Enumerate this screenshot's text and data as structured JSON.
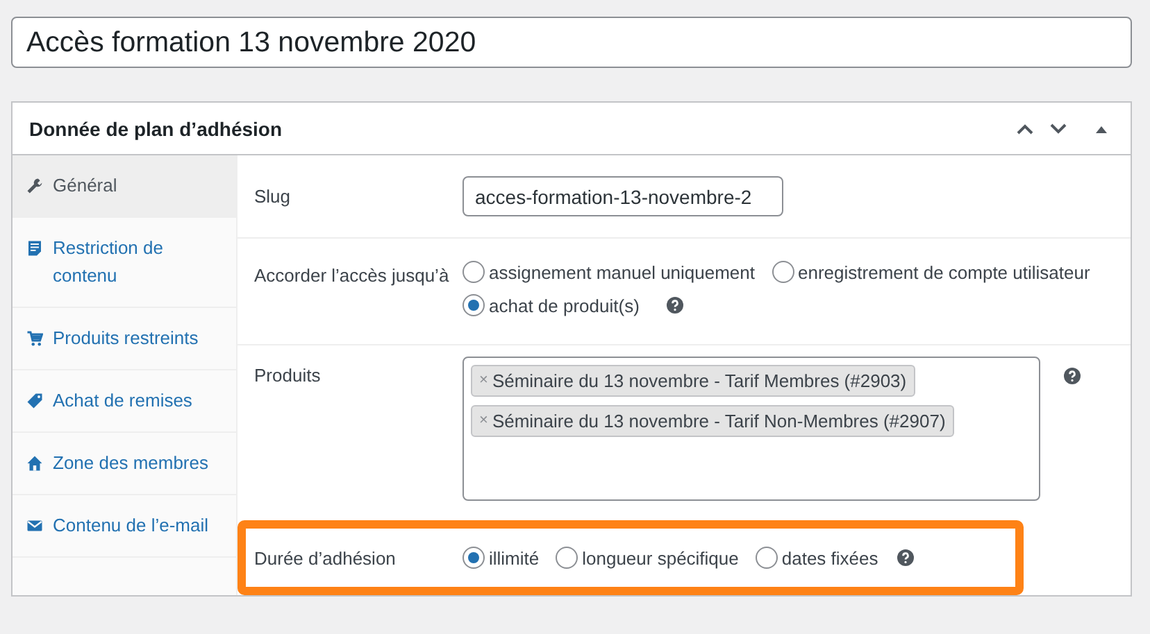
{
  "post_title": {
    "value": "Accès formation 13 novembre 2020"
  },
  "panel": {
    "title": "Donnée de plan d’adhésion"
  },
  "tabs": [
    {
      "kind": "wrench",
      "label": "Général",
      "selected": true
    },
    {
      "kind": "doc",
      "label": "Restriction de contenu",
      "selected": false
    },
    {
      "kind": "cart",
      "label": "Produits restreints",
      "selected": false
    },
    {
      "kind": "tag",
      "label": "Achat de remises",
      "selected": false
    },
    {
      "kind": "home",
      "label": "Zone des membres",
      "selected": false
    },
    {
      "kind": "mail",
      "label": "Contenu de l’e-mail",
      "selected": false
    }
  ],
  "slug": {
    "label": "Slug",
    "value": "acces-formation-13-novembre-2"
  },
  "access": {
    "label": "Accorder l’accès jusqu’à",
    "options": [
      {
        "label": "assignement manuel uniquement",
        "selected": false
      },
      {
        "label": "enregistrement de compte utilisateur",
        "selected": false
      },
      {
        "label": "achat de produit(s)",
        "selected": true
      }
    ]
  },
  "products": {
    "label": "Produits",
    "items": [
      {
        "remove": "×",
        "label": "Séminaire du 13 novembre - Tarif Membres (#2903)"
      },
      {
        "remove": "×",
        "label": "Séminaire du 13 novembre - Tarif Non-Membres (#2907)"
      }
    ]
  },
  "duration": {
    "label": "Durée d’adhésion",
    "highlighted": true,
    "options": [
      {
        "label": "illimité",
        "selected": true
      },
      {
        "label": "longueur spécifique",
        "selected": false
      },
      {
        "label": "dates fixées",
        "selected": false
      }
    ]
  }
}
